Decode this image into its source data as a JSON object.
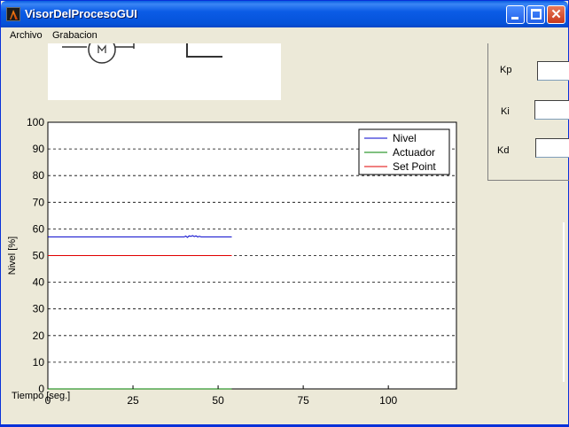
{
  "window": {
    "title": "VisorDelProcesoGUI"
  },
  "menu": [
    "Archivo",
    "Grabacion"
  ],
  "icons": {
    "app": "matlab-icon",
    "minimize": "minimize-icon",
    "maximize": "maximize-icon",
    "close": "close-icon"
  },
  "pid": {
    "kp_label": "Kp",
    "ki_label": "Ki",
    "kd_label": "Kd",
    "kp_value": "",
    "ki_value": "",
    "kd_value": ""
  },
  "chart_data": {
    "type": "line",
    "xlabel": "Tiempo [seg.]",
    "ylabel": "Nivel [%]",
    "xlim": [
      0,
      120
    ],
    "ylim": [
      0,
      100
    ],
    "xticks": [
      0,
      25,
      50,
      75,
      100
    ],
    "yticks": [
      0,
      10,
      20,
      30,
      40,
      50,
      60,
      70,
      80,
      90,
      100
    ],
    "grid": "horizontal-dashed",
    "legend": "top-right",
    "series": [
      {
        "name": "Nivel",
        "color": "#0000cc",
        "x": [
          0,
          40,
          40.5,
          41,
          41.5,
          42,
          42.5,
          43,
          43.5,
          44,
          44.5,
          45,
          54
        ],
        "y": [
          57,
          57,
          57.3,
          56.8,
          57.4,
          57.2,
          57.5,
          57.1,
          57.4,
          57.0,
          57.2,
          57,
          57
        ]
      },
      {
        "name": "Actuador",
        "color": "#008000",
        "x": [
          0,
          54
        ],
        "y": [
          0,
          0
        ]
      },
      {
        "name": "Set Point",
        "color": "#e00000",
        "x": [
          0,
          54
        ],
        "y": [
          50,
          50
        ]
      }
    ]
  }
}
